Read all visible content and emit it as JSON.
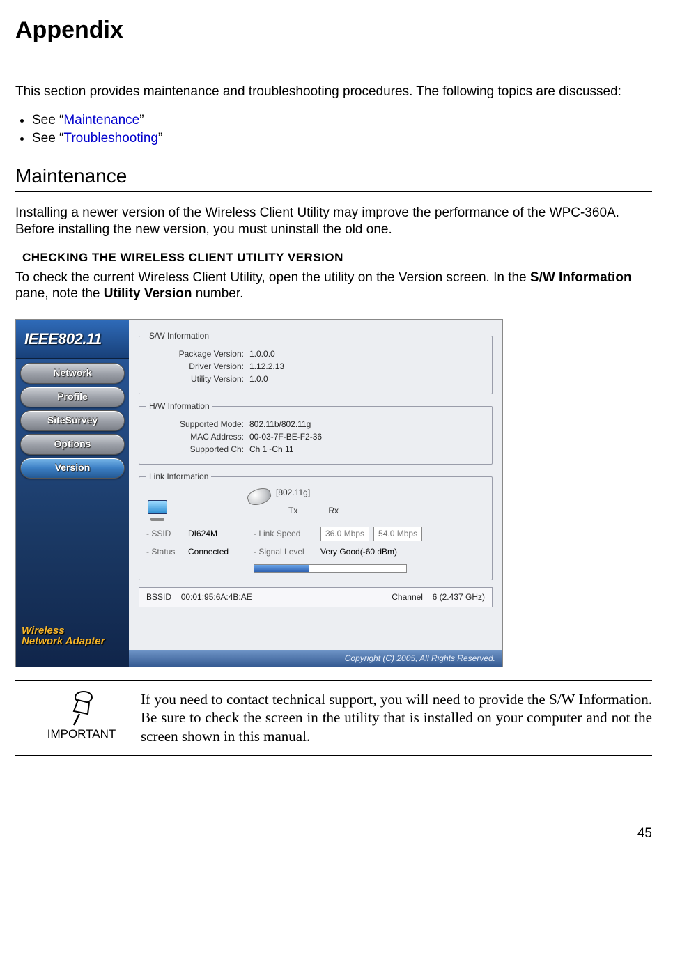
{
  "title": "Appendix",
  "intro": "This section provides maintenance and troubleshooting procedures. The following topics are discussed:",
  "bullets": [
    {
      "prefix": "See “",
      "link": "Maintenance",
      "suffix": "”"
    },
    {
      "prefix": "See “",
      "link": "Troubleshooting",
      "suffix": "”"
    }
  ],
  "maintenance_heading": "Maintenance",
  "maintenance_desc": "Installing a newer version of the Wireless Client Utility may improve the performance of the WPC-360A. Before installing the new version, you must uninstall the old one.",
  "subhead": "CHECKING THE WIRELESS CLIENT UTILITY VERSION",
  "check_desc_pre": "To check the current Wireless Client Utility, open the utility on the Version screen. In the ",
  "check_desc_bold1": "S/W Information",
  "check_desc_mid": " pane, note the ",
  "check_desc_bold2": "Utility Version",
  "check_desc_post": " number.",
  "window": {
    "brand": "IEEE802.11",
    "close_glyph": "✕",
    "nav": {
      "network": "Network",
      "profile": "Profile",
      "sitesurvey": "SiteSurvey",
      "options": "Options",
      "version": "Version"
    },
    "sidebar_footer": {
      "line1": "Wireless",
      "line2": "Network Adapter"
    },
    "sw_info": {
      "legend": "S/W Information",
      "package_label": "Package Version:",
      "package_value": "1.0.0.0",
      "driver_label": "Driver Version:",
      "driver_value": "1.12.2.13",
      "utility_label": "Utility Version:",
      "utility_value": "1.0.0"
    },
    "hw_info": {
      "legend": "H/W Information",
      "mode_label": "Supported Mode:",
      "mode_value": "802.11b/802.11g",
      "mac_label": "MAC Address:",
      "mac_value": "00-03-7F-BE-F2-36",
      "ch_label": "Supported Ch:",
      "ch_value": "Ch 1~Ch 11"
    },
    "link_info": {
      "legend": "Link Information",
      "band": "[802.11g]",
      "tx_label": "Tx",
      "rx_label": "Rx",
      "ssid_label": "- SSID",
      "ssid_value": "DI624M",
      "linkspeed_label": "- Link Speed",
      "tx_speed": "36.0 Mbps",
      "rx_speed": "54.0 Mbps",
      "status_label": "- Status",
      "status_value": "Connected",
      "signal_label": "- Signal Level",
      "signal_value": "Very Good(-60 dBm)"
    },
    "status_bar": {
      "bssid": "BSSID = 00:01:95:6A:4B:AE",
      "channel": "Channel = 6 (2.437 GHz)"
    },
    "copyright": "Copyright (C) 2005, All Rights Reserved."
  },
  "note": {
    "label": "IMPORTANT",
    "text": "If you need to contact technical support, you will need to provide the S/W Information. Be sure to check the screen in the utility that is installed on your computer and not the screen shown in this manual."
  },
  "page_number": "45"
}
